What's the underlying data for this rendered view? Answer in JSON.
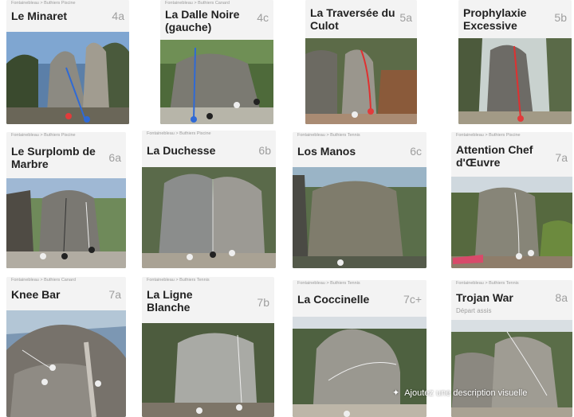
{
  "cards": [
    {
      "crumb": "Fontainebleau  >  Buthiers Piscine",
      "title": "Le Minaret",
      "grade": "4a"
    },
    {
      "crumb": "Fontainebleau  >  Buthiers Canard",
      "title": "La Dalle Noire\n(gauche)",
      "grade": "4c"
    },
    {
      "crumb": "",
      "title": "La Traversée du\nCulot",
      "grade": "5a"
    },
    {
      "crumb": "",
      "title": "Prophylaxie\nExcessive",
      "grade": "5b"
    },
    {
      "crumb": "Fontainebleau  >  Buthiers Piscine",
      "title": "Le Surplomb de\nMarbre",
      "grade": "6a"
    },
    {
      "crumb": "Fontainebleau  >  Buthiers Piscine",
      "title": "La Duchesse",
      "grade": "6b"
    },
    {
      "crumb": "Fontainebleau  >  Buthiers Tennis",
      "title": "Los Manos",
      "grade": "6c"
    },
    {
      "crumb": "Fontainebleau  >  Buthiers Piscine",
      "title": "Attention Chef\nd'Œuvre",
      "grade": "7a"
    },
    {
      "crumb": "Fontainebleau  >  Buthiers Canard",
      "title": "Knee Bar",
      "grade": "7a"
    },
    {
      "crumb": "Fontainebleau  >  Buthiers Tennis",
      "title": "La Ligne\nBlanche",
      "grade": "7b"
    },
    {
      "crumb": "Fontainebleau  >  Buthiers Tennis",
      "title": "La Coccinelle",
      "grade": "7c+"
    },
    {
      "crumb": "Fontainebleau  >  Buthiers Tennis",
      "title": "Trojan War",
      "grade": "8a",
      "subline": "Départ assis"
    }
  ],
  "overlay": {
    "icon": "sparkle-icon",
    "text": "Ajoutez une description visuelle"
  }
}
